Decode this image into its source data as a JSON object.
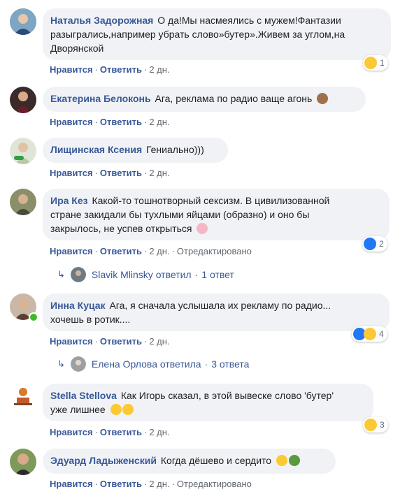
{
  "actions": {
    "like": "Нравится",
    "reply": "Ответить",
    "edited": "Отредактировано"
  },
  "comments": [
    {
      "author": "Наталья Задорожная",
      "text_line1": "О да!Мы насмеялись с мужем!Фантазии",
      "text_line2": "разыгрались,например убрать слово»бутер».Живем за углом,на",
      "text_line3": "Дворянской",
      "time": "2 дн.",
      "reaction_count": "1"
    },
    {
      "author": "Екатерина Белоконь",
      "text": "Ага, реклама по радио ваще агонь",
      "time": "2 дн."
    },
    {
      "author": "Лищинская Ксения",
      "text": "Гениально)))",
      "time": "2 дн."
    },
    {
      "author": "Ира Кез",
      "text_line1": "Какой-то тошнотворный сексизм. В цивилизованной",
      "text_line2": "стране закидали бы тухлыми яйцами (образно) и оно бы",
      "text_line3": "закрылось, не успев открыться",
      "time": "2 дн.",
      "reaction_count": "2",
      "replies": "Slavik Mlinsky ответил · 1 ответ",
      "replies_name": "Slavik Mlinsky ответил",
      "replies_count": "1 ответ"
    },
    {
      "author": "Инна Куцак",
      "text_line1": "Ага, я сначала услышала их рекламу по радио...",
      "text_line2": "хочешь в ротик....",
      "time": "2 дн.",
      "reaction_count": "4",
      "replies_name": "Елена Орлова ответила",
      "replies_count": "3 ответа"
    },
    {
      "author": "Stella Stellova",
      "text_line1": "Как Игорь сказал, в этой вывеске слово 'бутер'",
      "text_line2": "уже лишнее",
      "time": "2 дн.",
      "reaction_count": "3"
    },
    {
      "author": "Эдуард Ладыженский",
      "text": "Когда дёшево и сердито",
      "time": "2 дн."
    }
  ],
  "colors": {
    "link": "#385898",
    "bubble": "#f0f2f5",
    "muted": "#606770",
    "online": "#42b72a"
  },
  "icons": {
    "reply_arrow": "reply-arrow-icon",
    "haha": "haha-reaction-icon",
    "like": "like-reaction-icon",
    "wow": "wow-reaction-icon"
  }
}
